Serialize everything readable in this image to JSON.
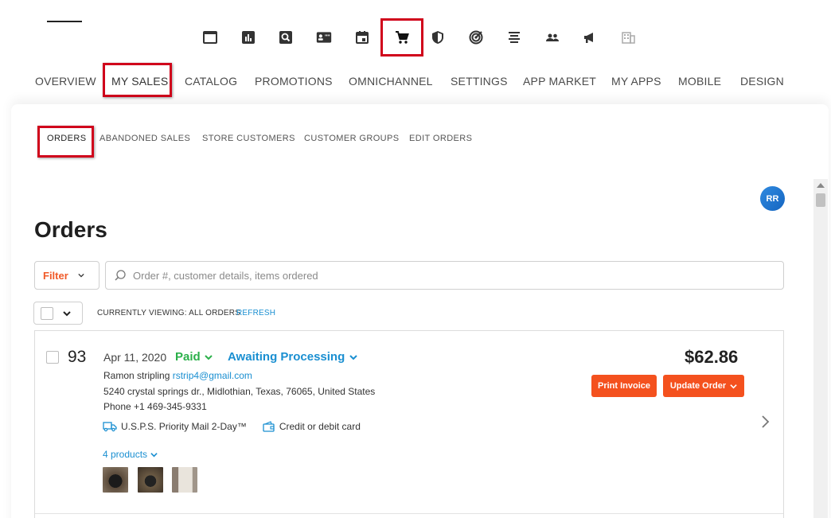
{
  "top_icons": [
    {
      "name": "dashboard-window-icon"
    },
    {
      "name": "reports-chart-icon"
    },
    {
      "name": "search-box-icon"
    },
    {
      "name": "contacts-card-icon"
    },
    {
      "name": "calendar-icon"
    },
    {
      "name": "shopping-cart-icon",
      "active": true
    },
    {
      "name": "security-shield-icon"
    },
    {
      "name": "target-radar-icon"
    },
    {
      "name": "text-align-icon"
    },
    {
      "name": "people-icon"
    },
    {
      "name": "megaphone-icon"
    },
    {
      "name": "building-icon"
    }
  ],
  "main_nav": [
    {
      "label": "OVERVIEW"
    },
    {
      "label": "MY SALES",
      "active": true
    },
    {
      "label": "CATALOG"
    },
    {
      "label": "PROMOTIONS"
    },
    {
      "label": "OMNICHANNEL"
    },
    {
      "label": "SETTINGS"
    },
    {
      "label": "APP MARKET"
    },
    {
      "label": "MY APPS"
    },
    {
      "label": "MOBILE"
    },
    {
      "label": "DESIGN"
    }
  ],
  "sub_nav": [
    {
      "label": "ORDERS",
      "active": true
    },
    {
      "label": "ABANDONED SALES"
    },
    {
      "label": "STORE CUSTOMERS"
    },
    {
      "label": "CUSTOMER GROUPS"
    },
    {
      "label": "EDIT ORDERS"
    }
  ],
  "user": {
    "initials": "RR"
  },
  "page": {
    "title": "Orders"
  },
  "filter": {
    "label": "Filter"
  },
  "search": {
    "placeholder": "Order #, customer details, items ordered",
    "value": ""
  },
  "list_header": {
    "viewing": "CURRENTLY VIEWING: ALL ORDERS",
    "refresh": "REFRESH"
  },
  "order": {
    "number": "93",
    "date": "Apr 11, 2020",
    "payment_status": "Paid",
    "fulfillment_status": "Awaiting Processing",
    "total": "$62.86",
    "customer_name": "Ramon stripling",
    "customer_email": "rstrip4@gmail.com",
    "address": "5240 crystal springs dr., Midlothian, Texas, 76065, United States",
    "phone": "Phone +1 469-345-9331",
    "shipping": "U.S.P.S. Priority Mail 2-Day™",
    "payment_method": "Credit or debit card",
    "products_link": "4 products",
    "print_invoice": "Print Invoice",
    "update_order": "Update Order"
  },
  "colors": {
    "accent_orange": "#f4511e",
    "link_blue": "#1a8fd1",
    "paid_green": "#2bb04a",
    "highlight_red": "#d0021b"
  }
}
